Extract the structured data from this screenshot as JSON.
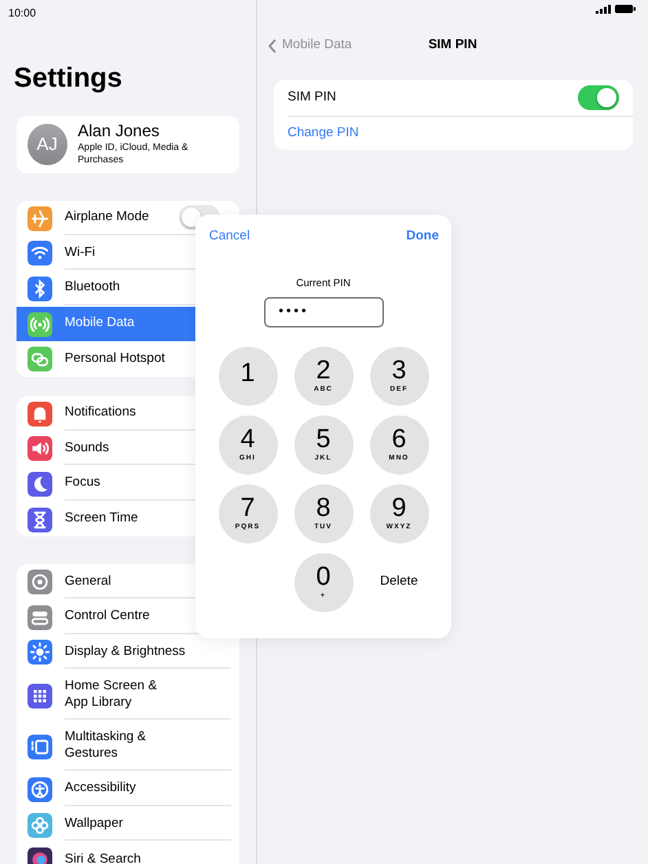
{
  "status_bar": {
    "time": "10:00"
  },
  "sidebar": {
    "title": "Settings",
    "profile": {
      "initials": "AJ",
      "name": "Alan Jones",
      "subtitle": "Apple ID, iCloud, Media & Purchases"
    },
    "groups": [
      [
        {
          "label": "Airplane Mode",
          "color": "#f19a37",
          "kind": "toggle",
          "on": false,
          "selected": false
        },
        {
          "label": "Wi-Fi",
          "color": "#3478f6",
          "kind": "nav",
          "selected": false
        },
        {
          "label": "Bluetooth",
          "color": "#3478f6",
          "kind": "nav",
          "selected": false
        },
        {
          "label": "Mobile Data",
          "color": "#5ac85a",
          "kind": "nav",
          "selected": true
        },
        {
          "label": "Personal Hotspot",
          "color": "#5ac85a",
          "kind": "nav",
          "selected": false
        }
      ],
      [
        {
          "label": "Notifications",
          "color": "#eb4e3d",
          "kind": "nav",
          "selected": false
        },
        {
          "label": "Sounds",
          "color": "#ea4461",
          "kind": "nav",
          "selected": false
        },
        {
          "label": "Focus",
          "color": "#5d5ce6",
          "kind": "nav",
          "selected": false
        },
        {
          "label": "Screen Time",
          "color": "#5d5ce6",
          "kind": "nav",
          "selected": false
        }
      ],
      [
        {
          "label": "General",
          "color": "#8e8e93",
          "kind": "nav",
          "selected": false
        },
        {
          "label": "Control Centre",
          "color": "#8e8e93",
          "kind": "nav",
          "selected": false
        },
        {
          "label": "Display & Brightness",
          "color": "#3478f6",
          "kind": "nav",
          "selected": false
        },
        {
          "label": "Home Screen & App Library",
          "color": "#5d5ce6",
          "kind": "nav",
          "selected": false
        },
        {
          "label": "Multitasking & Gestures",
          "color": "#3478f6",
          "kind": "nav",
          "selected": false
        },
        {
          "label": "Accessibility",
          "color": "#3478f6",
          "kind": "nav",
          "selected": false
        },
        {
          "label": "Wallpaper",
          "color": "#4fb7e0",
          "kind": "nav",
          "selected": false
        },
        {
          "label": "Siri & Search",
          "color": "#3a2a5a",
          "kind": "nav",
          "selected": false
        }
      ]
    ]
  },
  "detail": {
    "back": "Mobile Data",
    "title": "SIM PIN",
    "rows": [
      {
        "kind": "toggle",
        "label": "SIM PIN",
        "on": true
      },
      {
        "kind": "link",
        "label": "Change PIN"
      }
    ]
  },
  "pin_dialog": {
    "cancel": "Cancel",
    "done": "Done",
    "label": "Current PIN",
    "value": "••••",
    "keys": [
      {
        "digit": "1"
      },
      {
        "digit": "2",
        "letters": "ABC"
      },
      {
        "digit": "3",
        "letters": "DEF"
      },
      {
        "digit": "4",
        "letters": "GHI"
      },
      {
        "digit": "5",
        "letters": "JKL"
      },
      {
        "digit": "6",
        "letters": "MNO"
      },
      {
        "digit": "7",
        "letters": "PQRS"
      },
      {
        "digit": "8",
        "letters": "TUV"
      },
      {
        "digit": "9",
        "letters": "WXYZ"
      },
      {
        "digit": "0",
        "letters": "+"
      }
    ],
    "delete": "Delete"
  }
}
